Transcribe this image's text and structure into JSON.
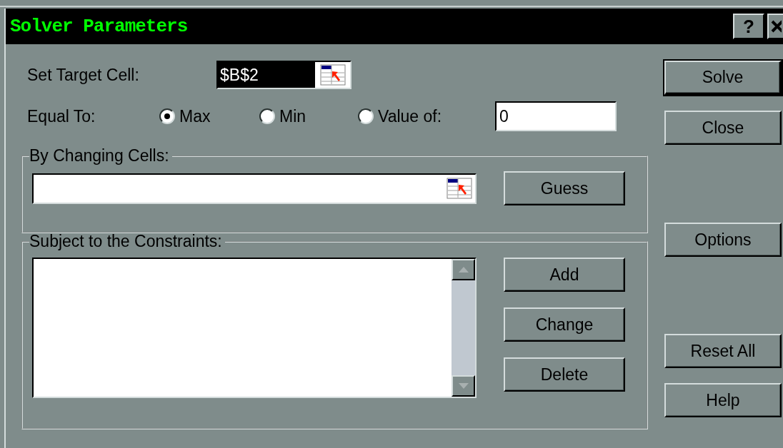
{
  "window": {
    "title": "Solver Parameters",
    "help_button": "?"
  },
  "target_cell": {
    "label": "Set Target Cell:",
    "value": "$B$2"
  },
  "equal_to": {
    "label": "Equal To:",
    "options": [
      {
        "label": "Max",
        "selected": true
      },
      {
        "label": "Min",
        "selected": false
      },
      {
        "label": "Value of:",
        "selected": false
      }
    ],
    "value_field": "0"
  },
  "changing_cells": {
    "title": "By Changing Cells:",
    "button": "Guess"
  },
  "constraints": {
    "title": "Subject to the Constraints:",
    "buttons": [
      "Add",
      "Change",
      "Delete"
    ]
  },
  "side_buttons": [
    {
      "label": "Solve",
      "default": true
    },
    {
      "label": "Close",
      "default": false
    },
    {
      "label": "Options",
      "default": false
    },
    {
      "label": "Reset All",
      "default": false
    },
    {
      "label": "Help",
      "default": false
    }
  ]
}
